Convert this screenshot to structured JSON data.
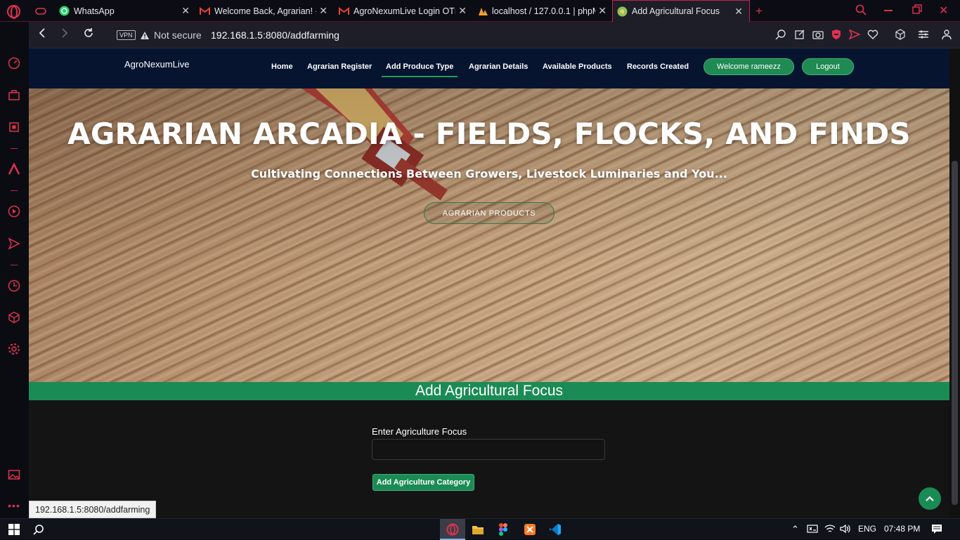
{
  "browser": {
    "tabs": [
      {
        "label": "WhatsApp",
        "icon": "whatsapp-icon"
      },
      {
        "label": "Welcome Back, Agrarian! - ",
        "icon": "gmail-icon"
      },
      {
        "label": "AgroNexumLive Login OTP",
        "icon": "gmail-icon"
      },
      {
        "label": "localhost / 127.0.0.1 | phpM",
        "icon": "phpmyadmin-icon"
      },
      {
        "label": "Add Agricultural Focus",
        "icon": "site-favicon",
        "active": true
      }
    ],
    "vpn_badge": "VPN",
    "security_text": "Not secure",
    "url_host": "192.168.1.5",
    "url_rest": ":8080/addfarming",
    "status_url": "192.168.1.5:8080/addfarming"
  },
  "site": {
    "brand": "AgroNexumLive",
    "nav": [
      {
        "label": "Home"
      },
      {
        "label": "Agrarian Register"
      },
      {
        "label": "Add Produce Type",
        "active": true
      },
      {
        "label": "Agrarian Details"
      },
      {
        "label": "Available Products"
      },
      {
        "label": "Records Created"
      }
    ],
    "welcome_label": "Welcome rameezz",
    "logout_label": "Logout",
    "accent_color": "#1b8b55",
    "navbar_color": "#061430"
  },
  "hero": {
    "title": "AGRARIAN ARCADIA - FIELDS, FLOCKS, AND FINDS",
    "subtitle": "Cultivating Connections Between Growers, Livestock Luminaries and You...",
    "button_label": "AGRARIAN PRODUCTS"
  },
  "form": {
    "section_title": "Add Agricultural Focus",
    "field_label": "Enter Agriculture Focus",
    "field_value": "",
    "field_placeholder": "",
    "submit_label": "Add Agriculture Category"
  },
  "taskbar": {
    "language": "ENG",
    "time": "07:48 PM"
  }
}
